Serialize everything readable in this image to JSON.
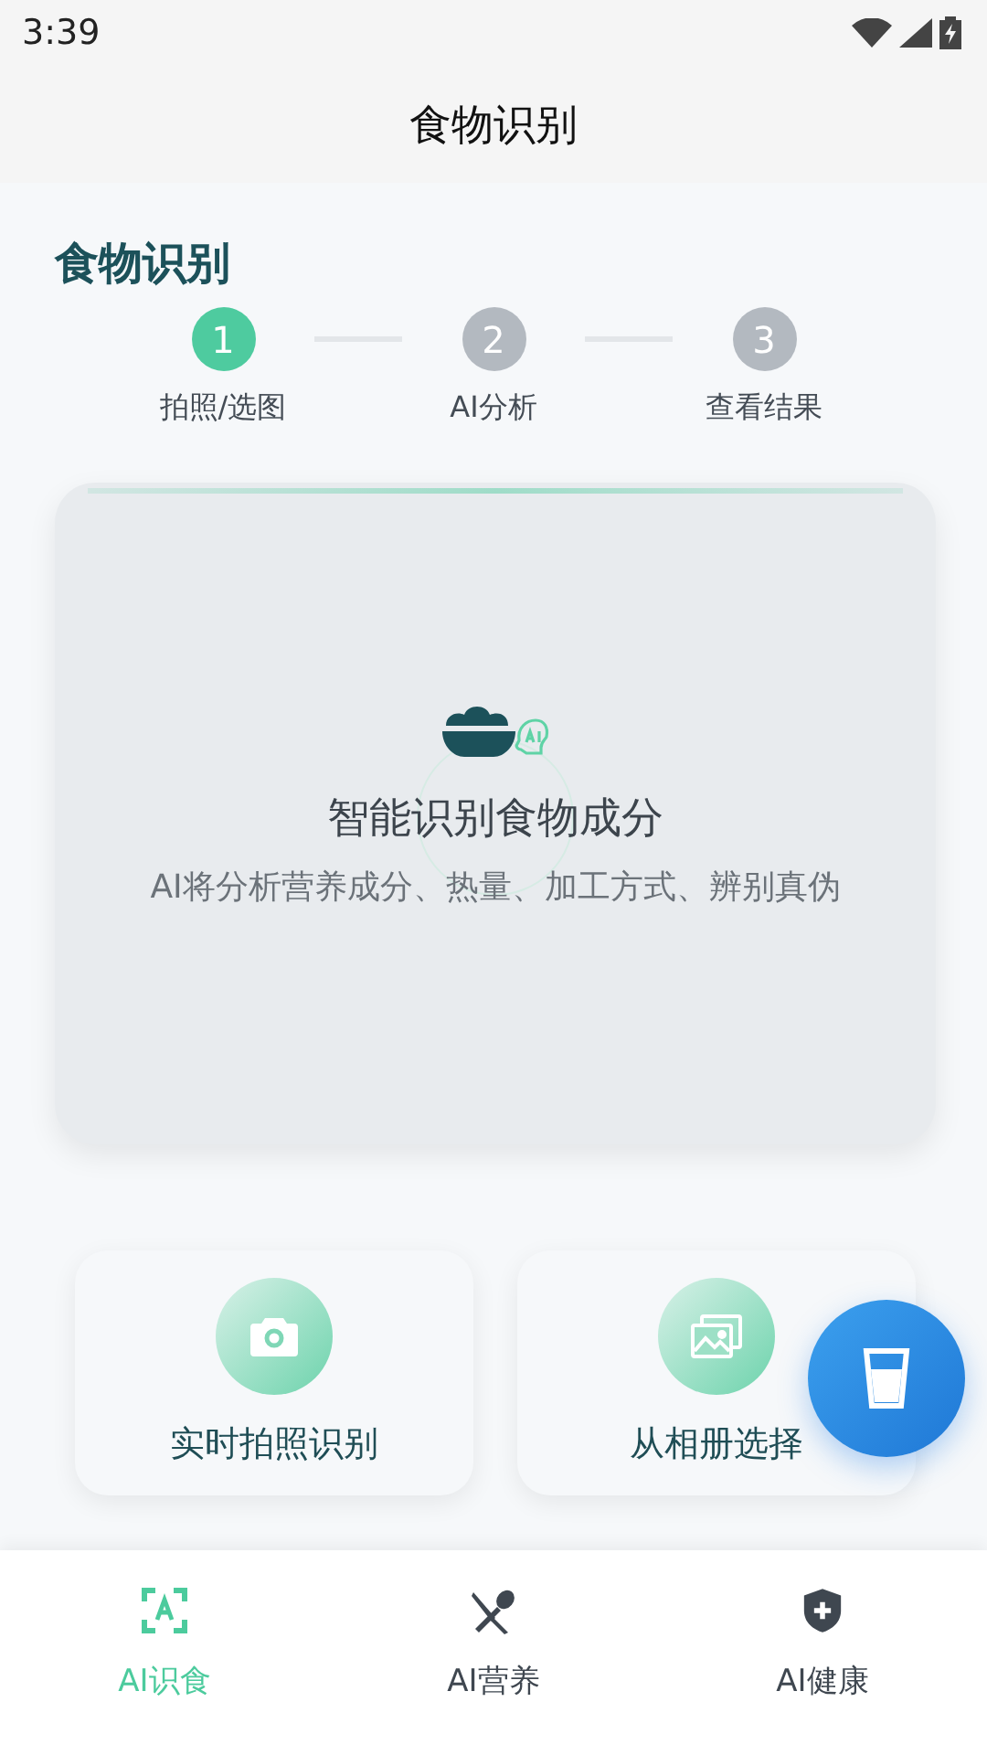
{
  "status_bar": {
    "time": "3:39"
  },
  "app_bar": {
    "title": "食物识别"
  },
  "section_title": "食物识别",
  "steps": [
    {
      "number": "1",
      "label": "拍照/选图",
      "selected": true
    },
    {
      "number": "2",
      "label": "AI分析",
      "selected": false
    },
    {
      "number": "3",
      "label": "查看结果",
      "selected": false
    }
  ],
  "scan_card": {
    "title": "智能识别食物成分",
    "subtitle": "AI将分析营养成分、热量、加工方式、辨别真伪"
  },
  "actions": [
    {
      "kind": "camera",
      "label": "实时拍照识别"
    },
    {
      "kind": "gallery",
      "label": "从相册选择"
    }
  ],
  "bottom_nav": [
    {
      "kind": "scan",
      "label": "AI识食",
      "selected": true
    },
    {
      "kind": "food",
      "label": "AI营养",
      "selected": false
    },
    {
      "kind": "health",
      "label": "AI健康",
      "selected": false
    }
  ]
}
